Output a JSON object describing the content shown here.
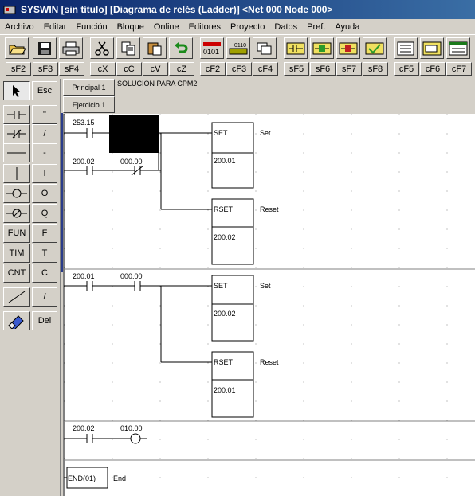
{
  "window": {
    "title": "SYSWIN [sin título] [Diagrama de relés (Ladder)] <Net 000 Node 000>"
  },
  "menu": [
    "Archivo",
    "Editar",
    "Función",
    "Bloque",
    "Online",
    "Editores",
    "Proyecto",
    "Datos",
    "Pref.",
    "Ayuda"
  ],
  "toolbar_icons": [
    "open-icon",
    "save-icon",
    "print-icon",
    "cut-icon",
    "copy-icon",
    "paste-icon",
    "undo-icon",
    "binary-icon",
    "bits-icon",
    "windows-icon",
    "contact-insert-icon",
    "rung-insert-icon",
    "rung-delete-icon",
    "rung-check-icon",
    "network-icon",
    "ase-icon",
    "monitor-icon"
  ],
  "fkeys": [
    "sF2",
    "sF3",
    "sF4",
    "cX",
    "cC",
    "cV",
    "cZ",
    "cF2",
    "cF3",
    "cF4",
    "sF5",
    "sF6",
    "sF7",
    "sF8",
    "cF5",
    "cF6",
    "cF7"
  ],
  "palette": {
    "keys": [
      "Esc",
      "\"",
      "/",
      "-",
      "I",
      "O",
      "Q",
      "F",
      "T",
      "C",
      "/",
      "Del"
    ],
    "labels": {
      "fun": "FUN",
      "tim": "TIM",
      "cnt": "CNT"
    }
  },
  "tabs": {
    "principal": "Principal 1",
    "ejercicio": "Ejercicio 1"
  },
  "program_title": "SOLUCION PARA CPM2",
  "ladder": {
    "r1_contact": "253.15",
    "r1_c2": "200.02",
    "r1_c3": "000.00",
    "set1_label": "SET",
    "set1_addr": "200.01",
    "set1_cmt": "Set",
    "rset1_label": "RSET",
    "rset1_addr": "200.02",
    "rset1_cmt": "Reset",
    "r2_c1": "200.01",
    "r2_c2": "000.00",
    "set2_label": "SET",
    "set2_addr": "200.02",
    "set2_cmt": "Set",
    "rset2_label": "RSET",
    "rset2_addr": "200.01",
    "rset2_cmt": "Reset",
    "r3_c1": "200.02",
    "r3_coil": "010.00",
    "end_label": "END(01)",
    "end_cmt": "End"
  }
}
